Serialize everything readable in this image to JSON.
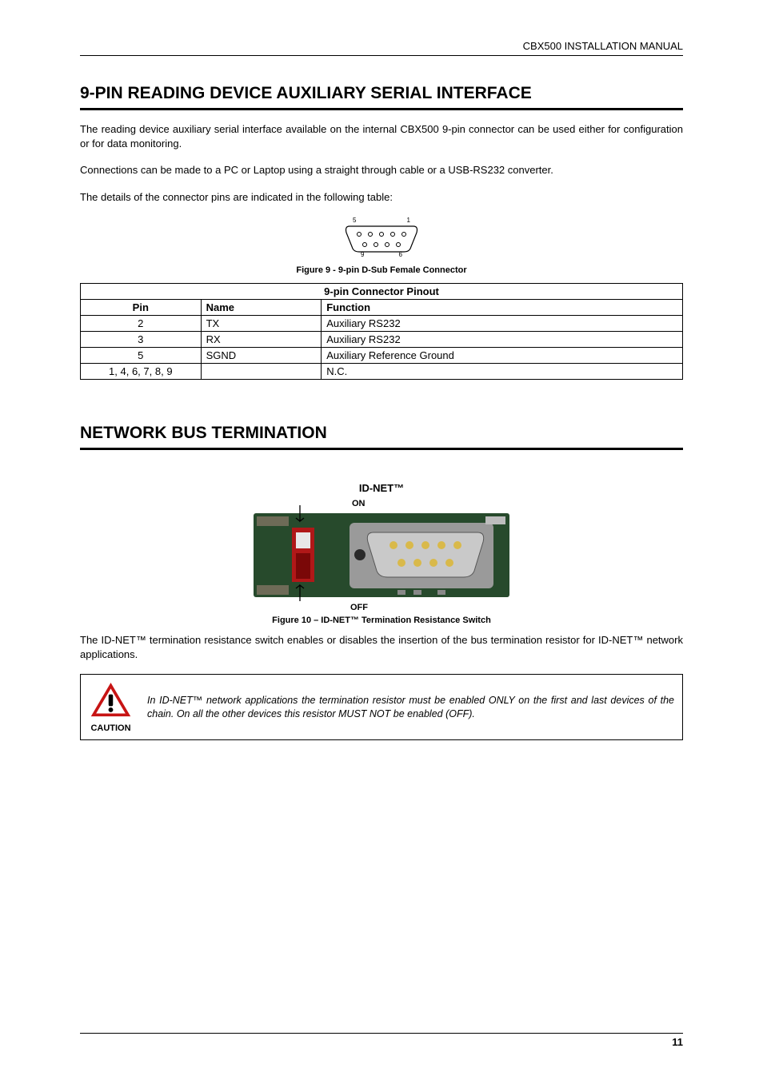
{
  "header": {
    "title": "CBX500 INSTALLATION MANUAL"
  },
  "section1": {
    "title": "9-PIN READING DEVICE AUXILIARY SERIAL INTERFACE",
    "para1": "The reading device auxiliary serial interface available on the internal CBX500 9-pin connector can be used either for configuration or for data monitoring.",
    "para2": "Connections can be made to a PC or Laptop using a straight through cable or a USB-RS232 converter.",
    "para3": "The details of the connector pins are indicated in the following table:",
    "pin_labels": {
      "tl": "5",
      "tr": "1",
      "bl": "9",
      "br": "6"
    },
    "figure_caption": "Figure 9 - 9-pin D-Sub Female Connector"
  },
  "pinout_table": {
    "title": "9-pin Connector Pinout",
    "cols": {
      "pin": "Pin",
      "name": "Name",
      "function": "Function"
    },
    "rows": [
      {
        "pin": "2",
        "name": "TX",
        "function": "Auxiliary RS232"
      },
      {
        "pin": "3",
        "name": "RX",
        "function": "Auxiliary RS232"
      },
      {
        "pin": "5",
        "name": "SGND",
        "function": "Auxiliary Reference Ground"
      },
      {
        "pin": "1, 4, 6, 7, 8, 9",
        "name": "",
        "function": "N.C."
      }
    ]
  },
  "section2": {
    "title": "NETWORK BUS TERMINATION",
    "subtitle": "ID-NET™",
    "on_label": "ON",
    "off_label": "OFF",
    "figure_caption": "Figure 10 – ID-NET™ Termination Resistance Switch",
    "para": "The ID-NET™ termination resistance switch enables or disables the insertion of the bus termination resistor for ID-NET™ network applications."
  },
  "caution": {
    "label": "CAUTION",
    "text": "In ID-NET™ network applications the termination resistor must be enabled ONLY on the first and last devices of the chain. On all the other devices this resistor MUST NOT be enabled (OFF)."
  },
  "footer": {
    "page_number": "11"
  }
}
